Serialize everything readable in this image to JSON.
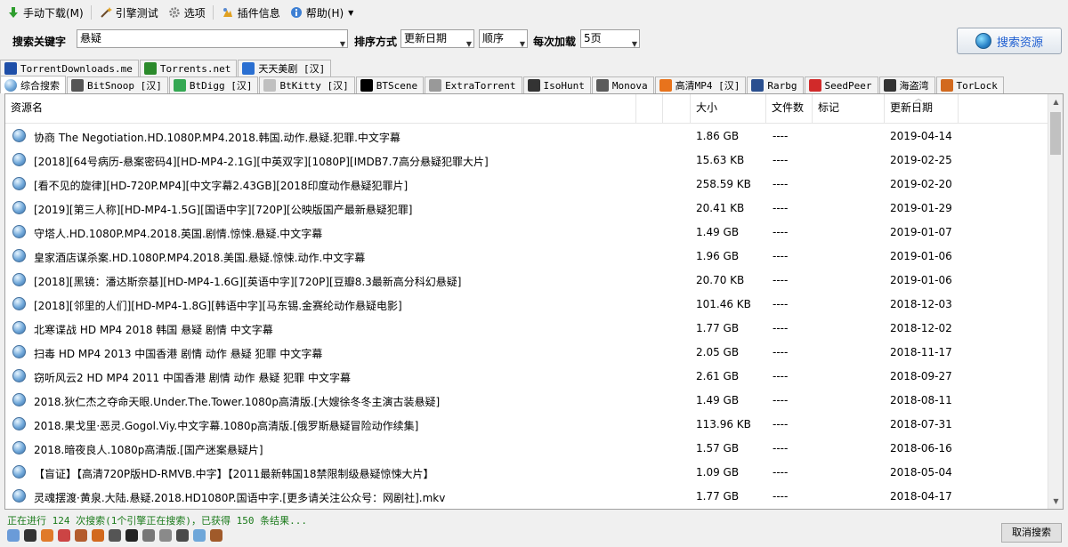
{
  "menubar": {
    "items": [
      {
        "label": "手动下载(M)",
        "icon": "download-arrow-icon"
      },
      {
        "label": "引擎测试",
        "icon": "wand-icon"
      },
      {
        "label": "选项",
        "icon": "gear-icon"
      },
      {
        "label": "插件信息",
        "icon": "plugin-icon"
      },
      {
        "label": "帮助(H)",
        "icon": "info-icon"
      }
    ]
  },
  "search": {
    "keyword_label": "搜索关键字",
    "keyword_value": "悬疑",
    "sort_label": "排序方式",
    "sort_value": "更新日期",
    "order_value": "顺序",
    "per_label": "每次加载",
    "per_value": "5页",
    "search_button": "搜索资源"
  },
  "tabs_row1": [
    {
      "label": "TorrentDownloads.me",
      "icon": "td-icon",
      "color": "#1f4fa8"
    },
    {
      "label": "Torrents.net",
      "icon": "tn-icon",
      "color": "#2b8a2b"
    },
    {
      "label": "天天美剧 [汉]",
      "icon": "tt-icon",
      "color": "#2a6fd1"
    }
  ],
  "tabs_row2": [
    {
      "label": "综合搜索",
      "icon": "globe-icon",
      "color": "#4a88c7",
      "active": true
    },
    {
      "label": "BitSnoop [汉]",
      "icon": "bitsnoop-icon",
      "color": "#555555"
    },
    {
      "label": "BtDigg [汉]",
      "icon": "btdigg-icon",
      "color": "#34a853"
    },
    {
      "label": "BtKitty [汉]",
      "icon": "btkitty-icon",
      "color": "#c0c0c0"
    },
    {
      "label": "BTScene",
      "icon": "btscene-icon",
      "color": "#000000"
    },
    {
      "label": "ExtraTorrent",
      "icon": "extratorrent-icon",
      "color": "#999999"
    },
    {
      "label": "IsoHunt",
      "icon": "isohunt-icon",
      "color": "#333333"
    },
    {
      "label": "Monova",
      "icon": "monova-icon",
      "color": "#5b5b5b"
    },
    {
      "label": "高清MP4 [汉]",
      "icon": "play-icon",
      "color": "#e8731c"
    },
    {
      "label": "Rarbg",
      "icon": "rarbg-icon",
      "color": "#2a4f8f"
    },
    {
      "label": "SeedPeer",
      "icon": "seedpeer-icon",
      "color": "#d12a2a"
    },
    {
      "label": "海盗湾",
      "icon": "pirate-icon",
      "color": "#333333"
    },
    {
      "label": "TorLock",
      "icon": "torlock-icon",
      "color": "#d2691e"
    }
  ],
  "columns": {
    "name": "资源名",
    "size": "大小",
    "files": "文件数",
    "tag": "标记",
    "date": "更新日期"
  },
  "rows": [
    {
      "name": "协商 The Negotiation.HD.1080P.MP4.2018.韩国.动作.悬疑.犯罪.中文字幕",
      "size": "1.86 GB",
      "files": "----",
      "date": "2019-04-14"
    },
    {
      "name": "[2018][64号病历-悬案密码4][HD-MP4-2.1G][中英双字][1080P][IMDB7.7高分悬疑犯罪大片]",
      "size": "15.63 KB",
      "files": "----",
      "date": "2019-02-25"
    },
    {
      "name": "[看不见的旋律][HD-720P.MP4][中文字幕2.43GB][2018印度动作悬疑犯罪片]",
      "size": "258.59 KB",
      "files": "----",
      "date": "2019-02-20"
    },
    {
      "name": "[2019][第三人称][HD-MP4-1.5G][国语中字][720P][公映版国产最新悬疑犯罪]",
      "size": "20.41 KB",
      "files": "----",
      "date": "2019-01-29"
    },
    {
      "name": "守塔人.HD.1080P.MP4.2018.英国.剧情.惊悚.悬疑.中文字幕",
      "size": "1.49 GB",
      "files": "----",
      "date": "2019-01-07"
    },
    {
      "name": "皇家酒店谋杀案.HD.1080P.MP4.2018.美国.悬疑.惊悚.动作.中文字幕",
      "size": "1.96 GB",
      "files": "----",
      "date": "2019-01-06"
    },
    {
      "name": "[2018][黑镜：潘达斯奈基][HD-MP4-1.6G][英语中字][720P][豆瓣8.3最新高分科幻悬疑]",
      "size": "20.70 KB",
      "files": "----",
      "date": "2019-01-06"
    },
    {
      "name": "[2018][邻里的人们][HD-MP4-1.8G][韩语中字][马东锡.金赛纶动作悬疑电影]",
      "size": "101.46 KB",
      "files": "----",
      "date": "2018-12-03"
    },
    {
      "name": "北寒谍战 HD MP4 2018 韩国 悬疑 剧情 中文字幕",
      "size": "1.77 GB",
      "files": "----",
      "date": "2018-12-02"
    },
    {
      "name": "扫毒 HD MP4 2013 中国香港 剧情 动作 悬疑 犯罪 中文字幕",
      "size": "2.05 GB",
      "files": "----",
      "date": "2018-11-17"
    },
    {
      "name": "窃听风云2 HD MP4 2011 中国香港 剧情 动作 悬疑 犯罪 中文字幕",
      "size": "2.61 GB",
      "files": "----",
      "date": "2018-09-27"
    },
    {
      "name": "2018.狄仁杰之夺命天眼.Under.The.Tower.1080p高清版.[大嫂徐冬冬主演古装悬疑]",
      "size": "1.49 GB",
      "files": "----",
      "date": "2018-08-11"
    },
    {
      "name": "2018.果戈里·恶灵.Gogol.Viy.中文字幕.1080p高清版.[俄罗斯悬疑冒险动作续集]",
      "size": "113.96 KB",
      "files": "----",
      "date": "2018-07-31"
    },
    {
      "name": "2018.暗夜良人.1080p高清版.[国产迷案悬疑片]",
      "size": "1.57 GB",
      "files": "----",
      "date": "2018-06-16"
    },
    {
      "name": "【盲证】【高清720P版HD-RMVB.中字】【2011最新韩国18禁限制级悬疑惊悚大片】",
      "size": "1.09 GB",
      "files": "----",
      "date": "2018-05-04"
    },
    {
      "name": "灵魂摆渡·黄泉.大陆.悬疑.2018.HD1080P.国语中字.[更多请关注公众号：网剧社].mkv",
      "size": "1.77 GB",
      "files": "----",
      "date": "2018-04-17"
    }
  ],
  "status": {
    "text": "正在进行 124 次搜索(1个引擎正在搜索)，已获得 150 条结果...",
    "cancel_button": "取消搜索"
  }
}
